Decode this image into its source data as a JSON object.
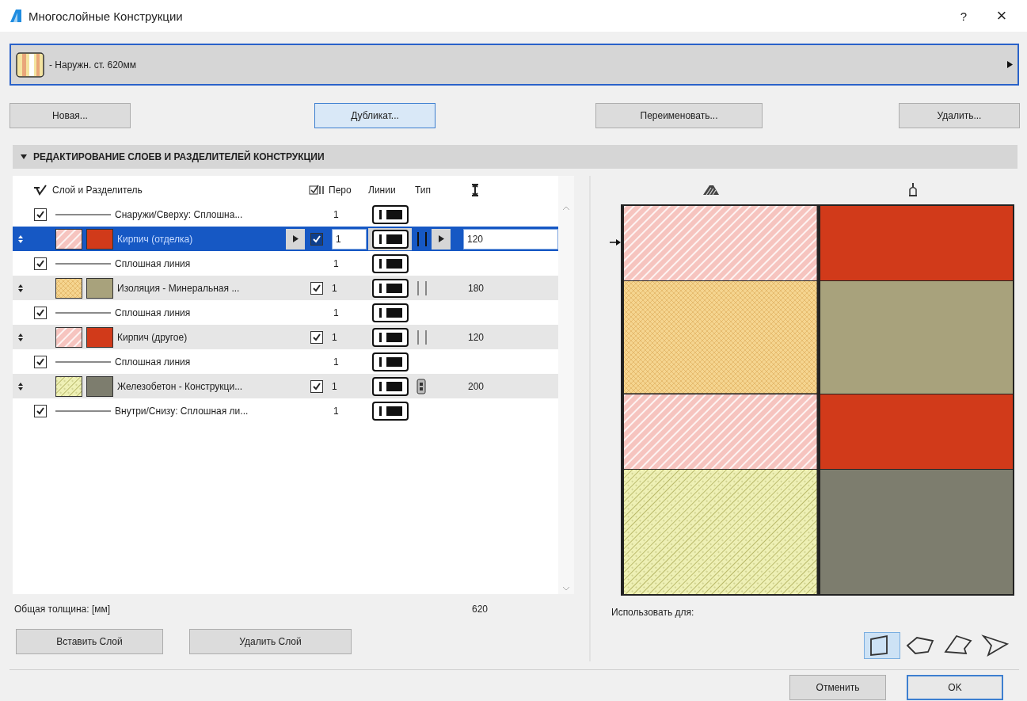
{
  "window": {
    "title": "Многослойные Конструкции",
    "help": "?",
    "close": "×"
  },
  "composite": {
    "name": "- Наружн. ст. 620мм"
  },
  "buttons": [
    {
      "label": "Новая...",
      "focused": false
    },
    {
      "label": "Дубликат...",
      "focused": true
    },
    {
      "label": "Переименовать...",
      "focused": false
    },
    {
      "label": "Удалить...",
      "focused": false
    }
  ],
  "section": {
    "title": "РЕДАКТИРОВАНИЕ СЛОЕВ И РАЗДЕЛИТЕЛЕЙ КОНСТРУКЦИИ",
    "expanded": true
  },
  "table": {
    "columns": {
      "name": "Слой и Разделитель",
      "pen": "Перо",
      "lines": "Линии",
      "type": "Тип"
    },
    "rows": [
      {
        "kind": "line",
        "checked": true,
        "name": "Снаружи/Сверху: Сплошна...",
        "pen": "1"
      },
      {
        "kind": "layer",
        "selected": true,
        "visible": true,
        "name": "Кирпич (отделка)",
        "pen": "1",
        "thickness": "120",
        "cut_fill": {
          "kind": "brick",
          "color": "#f6c4bf"
        },
        "surface": {
          "color": "#d13a1a"
        },
        "core": false
      },
      {
        "kind": "line",
        "checked": true,
        "name": "Сплошная линия",
        "pen": "1"
      },
      {
        "kind": "layer",
        "selected": false,
        "visible": true,
        "name": "Изоляция - Минеральная ...",
        "pen": "1",
        "thickness": "180",
        "cut_fill": {
          "kind": "insulation",
          "color": "#f5d590"
        },
        "surface": {
          "color": "#a8a27c"
        },
        "core": false
      },
      {
        "kind": "line",
        "checked": true,
        "name": "Сплошная линия",
        "pen": "1"
      },
      {
        "kind": "layer",
        "selected": false,
        "visible": true,
        "name": "Кирпич (другое)",
        "pen": "1",
        "thickness": "120",
        "cut_fill": {
          "kind": "brick",
          "color": "#f6c4bf"
        },
        "surface": {
          "color": "#d13a1a"
        },
        "core": false
      },
      {
        "kind": "line",
        "checked": true,
        "name": "Сплошная линия",
        "pen": "1"
      },
      {
        "kind": "layer",
        "selected": false,
        "visible": true,
        "name": "Железобетон - Конструкци...",
        "pen": "1",
        "thickness": "200",
        "cut_fill": {
          "kind": "concrete",
          "color": "#eef0b5"
        },
        "surface": {
          "color": "#7d7d6e"
        },
        "core": true
      },
      {
        "kind": "line",
        "checked": true,
        "name": "Внутри/Снизу: Сплошная ли...",
        "pen": "1"
      }
    ]
  },
  "total": {
    "label": "Общая толщина: [мм]",
    "value": "620"
  },
  "layer_buttons": [
    "Вставить Слой",
    "Удалить Слой"
  ],
  "use_for": {
    "label": "Использовать для:",
    "options": [
      {
        "selected": true
      },
      {
        "selected": false
      },
      {
        "selected": false
      },
      {
        "selected": false
      }
    ]
  },
  "dialog_buttons": [
    {
      "label": "Отменить",
      "default": false
    },
    {
      "label": "OK",
      "default": true
    }
  ]
}
